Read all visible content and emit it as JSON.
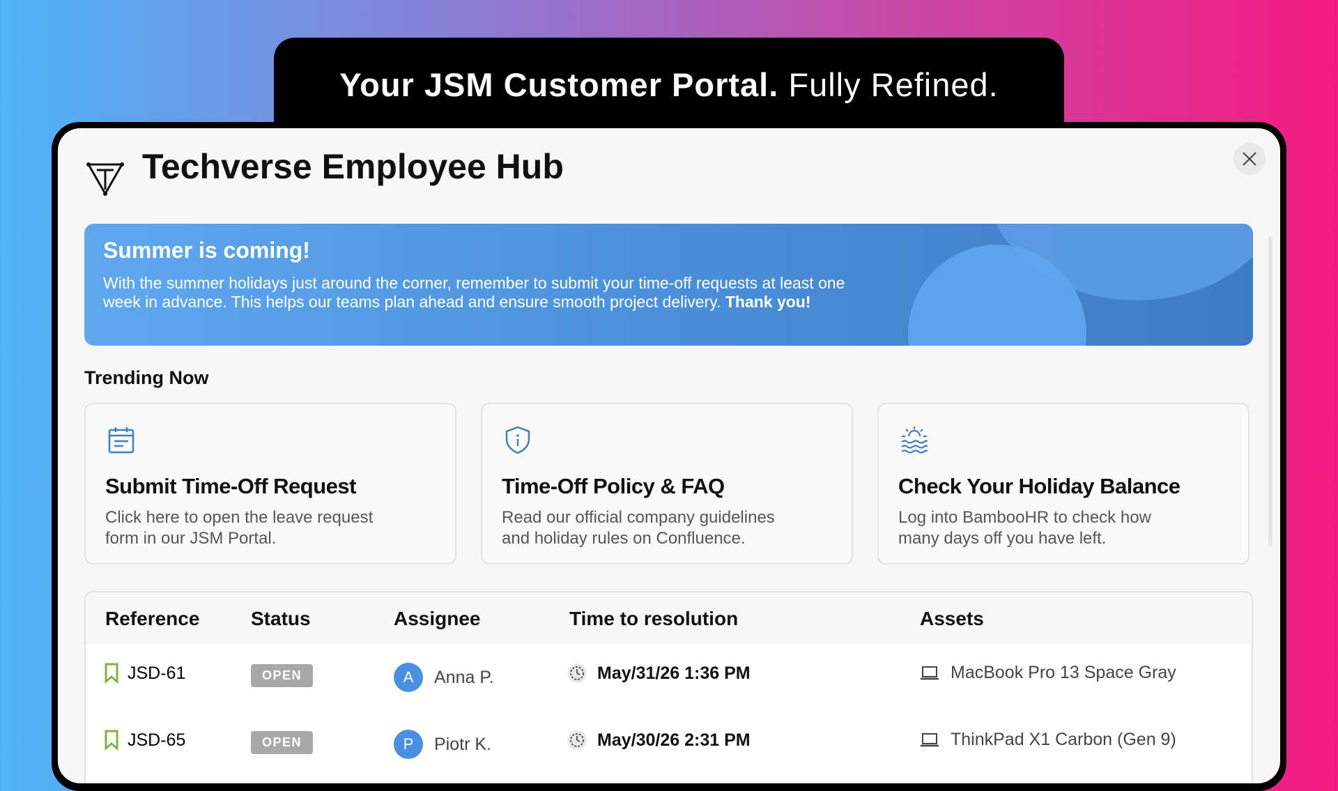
{
  "hero": {
    "bold": "Your JSM Customer Portal.",
    "light": "Fully Refined."
  },
  "app": {
    "title": "Techverse Employee Hub"
  },
  "banner": {
    "title": "Summer is coming!",
    "body": "With the summer holidays just around the corner, remember to submit your time-off requests at least one week in advance. This helps our teams plan ahead and ensure smooth project delivery.",
    "emphasis": "Thank you!"
  },
  "trending": {
    "title": "Trending Now",
    "cards": [
      {
        "icon": "calendar-icon",
        "title": "Submit Time-Off Request",
        "desc": "Click here to open the leave request form in our JSM Portal."
      },
      {
        "icon": "shield-info-icon",
        "title": "Time-Off Policy & FAQ",
        "desc": "Read our official company guidelines and holiday rules on Confluence."
      },
      {
        "icon": "sun-waves-icon",
        "title": "Check Your Holiday Balance",
        "desc": "Log into BambooHR to check how many days off you have left."
      }
    ]
  },
  "table": {
    "headers": [
      "Reference",
      "Status",
      "Assignee",
      "Time to resolution",
      "Assets"
    ],
    "rows": [
      {
        "ref": "JSD-61",
        "status": "OPEN",
        "initial": "A",
        "assignee": "Anna P.",
        "time": "May/31/26 1:36 PM",
        "asset": "MacBook Pro 13 Space Gray"
      },
      {
        "ref": "JSD-65",
        "status": "OPEN",
        "initial": "P",
        "assignee": "Piotr K.",
        "time": "May/30/26 2:31 PM",
        "asset": "ThinkPad X1 Carbon (Gen 9)"
      }
    ]
  },
  "colors": {
    "accent": "#4a90e2",
    "bookmark": "#7cb342",
    "badge": "#a8a8a8"
  }
}
